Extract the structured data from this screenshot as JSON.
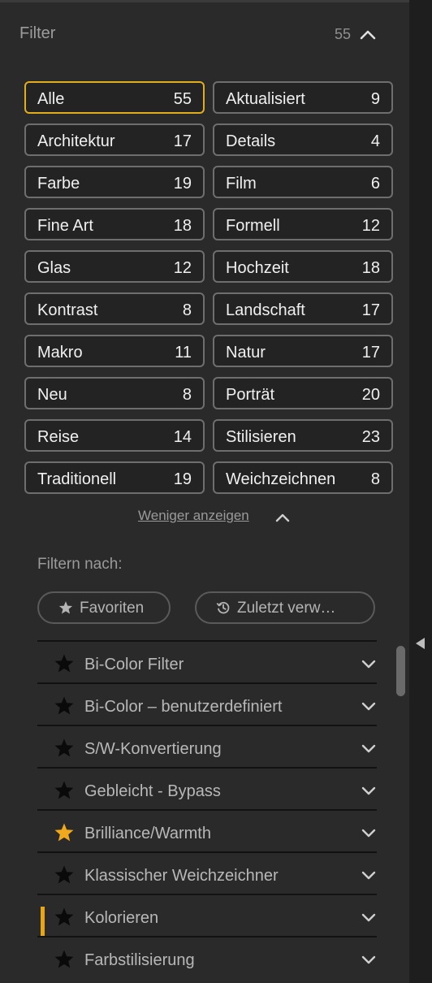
{
  "header": {
    "title": "Filter",
    "count": "55"
  },
  "categories": [
    {
      "label": "Alle",
      "count": "55",
      "active": true
    },
    {
      "label": "Aktualisiert",
      "count": "9"
    },
    {
      "label": "Architektur",
      "count": "17"
    },
    {
      "label": "Details",
      "count": "4"
    },
    {
      "label": "Farbe",
      "count": "19"
    },
    {
      "label": "Film",
      "count": "6"
    },
    {
      "label": "Fine Art",
      "count": "18"
    },
    {
      "label": "Formell",
      "count": "12"
    },
    {
      "label": "Glas",
      "count": "12"
    },
    {
      "label": "Hochzeit",
      "count": "18"
    },
    {
      "label": "Kontrast",
      "count": "8"
    },
    {
      "label": "Landschaft",
      "count": "17"
    },
    {
      "label": "Makro",
      "count": "11"
    },
    {
      "label": "Natur",
      "count": "17"
    },
    {
      "label": "Neu",
      "count": "8"
    },
    {
      "label": "Porträt",
      "count": "20"
    },
    {
      "label": "Reise",
      "count": "14"
    },
    {
      "label": "Stilisieren",
      "count": "23"
    },
    {
      "label": "Traditionell",
      "count": "19"
    },
    {
      "label": "Weichzeichnen",
      "count": "8"
    }
  ],
  "show_less": "Weniger anzeigen",
  "filter_by": {
    "label": "Filtern nach:",
    "favorites": "Favoriten",
    "recent": "Zuletzt verw…"
  },
  "filters": [
    {
      "name": "Bi-Color Filter",
      "favorite": false
    },
    {
      "name": "Bi-Color – benutzerdefiniert",
      "favorite": false
    },
    {
      "name": "S/W-Konvertierung",
      "favorite": false
    },
    {
      "name": "Gebleicht - Bypass",
      "favorite": false
    },
    {
      "name": "Brilliance/Warmth",
      "favorite": true
    },
    {
      "name": "Klassischer Weichzeichner",
      "favorite": false
    },
    {
      "name": "Kolorieren",
      "favorite": false,
      "selected": true
    },
    {
      "name": "Farbstilisierung",
      "favorite": false
    }
  ],
  "colors": {
    "accent": "#e2ad1b",
    "favorite_star": "#f0a81c",
    "star": "#0a0a0a"
  },
  "icons": {
    "collapse": "chevron-up-icon",
    "expand": "chevron-down-icon",
    "favorite": "star-icon",
    "recent": "history-icon"
  }
}
